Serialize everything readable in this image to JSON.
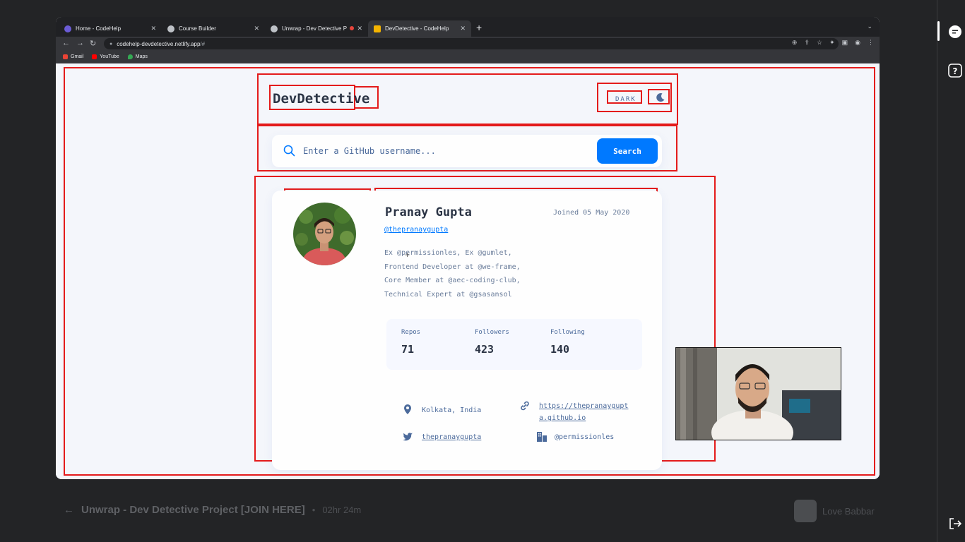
{
  "browser": {
    "tabs": [
      {
        "label": "Home - CodeHelp",
        "active": false
      },
      {
        "label": "Course Builder",
        "active": false
      },
      {
        "label": "Unwrap - Dev Detective P",
        "active": false
      },
      {
        "label": "DevDetective - CodeHelp",
        "active": true
      }
    ],
    "new_tab": "+",
    "url_host": "codehelp-devdetective.netlify.app",
    "url_path": "/#",
    "bookmarks": [
      "Gmail",
      "YouTube",
      "Maps"
    ]
  },
  "app": {
    "logo": "DevDetective",
    "mode_label": "DARK",
    "mode_icon": "moon-icon",
    "search_placeholder": "Enter a GitHub username...",
    "search_button": "Search",
    "profile": {
      "name": "Pranay Gupta",
      "joined": "Joined 05 May 2020",
      "handle": "@thepranaygupta",
      "bio": [
        "Ex @permissionles, Ex @gumlet,",
        "Frontend Developer at @we-frame,",
        "Core Member at @aec-coding-club,",
        "Technical Expert at @gsasansol"
      ],
      "stats": [
        {
          "label": "Repos",
          "value": "71"
        },
        {
          "label": "Followers",
          "value": "423"
        },
        {
          "label": "Following",
          "value": "140"
        }
      ],
      "location": "Kolkata, India",
      "blog_line1": "https://thepranaygupt",
      "blog_line2": "a.github.io",
      "twitter": "thepranaygupta",
      "company": "@permissionles"
    },
    "accent": "#0079ff",
    "annotation_color": "#e41b1b"
  },
  "lecture": {
    "title": "Unwrap - Dev Detective Project [JOIN HERE]",
    "separator": "•",
    "duration": "02hr 24m",
    "author": "Love Babbar"
  },
  "rail": {
    "icons": [
      "chat-icon",
      "help-icon",
      "exit-icon"
    ]
  }
}
